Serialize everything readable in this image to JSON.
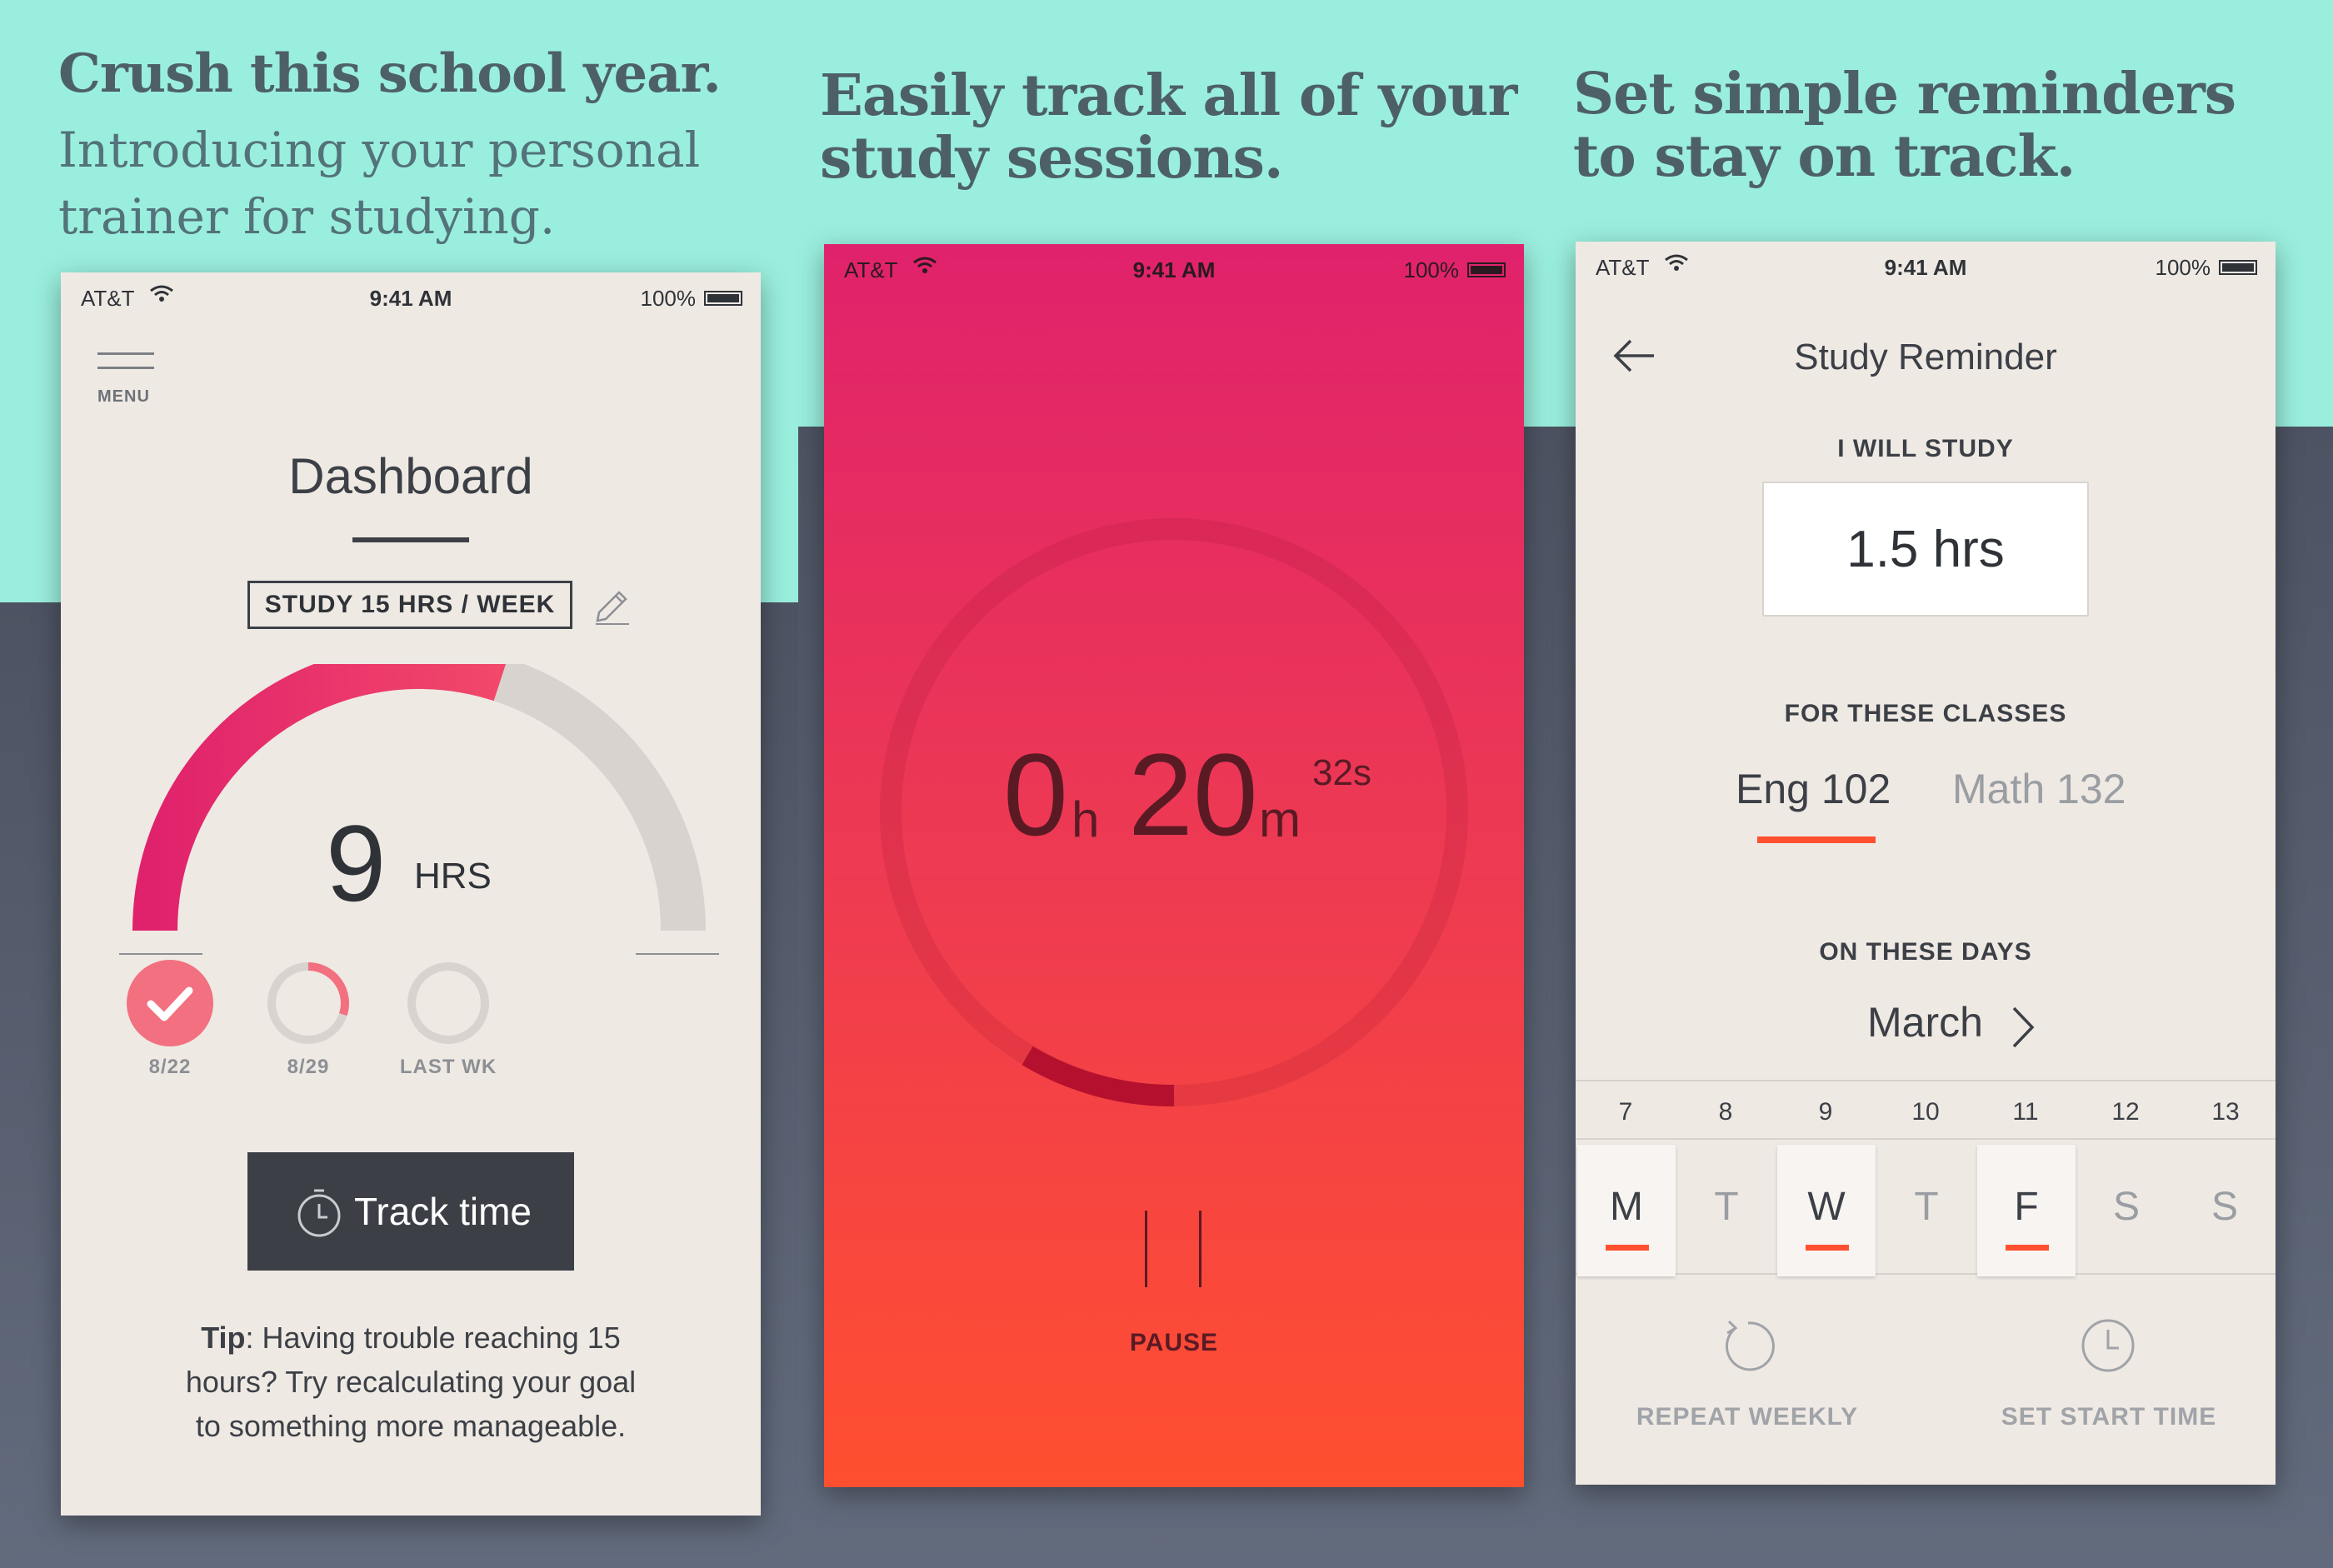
{
  "panels": [
    {
      "headline": "Crush this school year.",
      "subheadline_lines": [
        "Introducing your personal",
        "trainer for studying."
      ]
    },
    {
      "headline_lines": [
        "Easily track all of your",
        "study sessions."
      ]
    },
    {
      "headline_lines": [
        "Set simple reminders",
        "to stay on track."
      ]
    }
  ],
  "status_bar": {
    "carrier": "AT&T",
    "time": "9:41 AM",
    "battery": "100%"
  },
  "dashboard": {
    "menu_label": "MENU",
    "title": "Dashboard",
    "goal": "STUDY 15 HRS / WEEK",
    "hours_value": "9",
    "hours_unit": "HRS",
    "progress_fraction": 0.6,
    "weeks": [
      {
        "label": "8/22",
        "status": "complete"
      },
      {
        "label": "8/29",
        "status": "partial",
        "fraction": 0.3
      },
      {
        "label": "LAST WK",
        "status": "empty"
      }
    ],
    "track_button": "Track time",
    "tip_label": "Tip",
    "tip_lines": [
      ": Having trouble reaching 15",
      "hours? Try recalculating your goal",
      "to something more manageable."
    ]
  },
  "timer": {
    "hours": "0",
    "hours_suffix": "h",
    "minutes": "20",
    "minutes_suffix": "m",
    "seconds": "32s",
    "pause_label": "PAUSE"
  },
  "reminder": {
    "title": "Study Reminder",
    "will_study_label": "I WILL STUDY",
    "hours": "1.5 hrs",
    "classes_label": "FOR THESE CLASSES",
    "classes": [
      {
        "name": "Eng 102",
        "selected": true
      },
      {
        "name": "Math 132",
        "selected": false
      }
    ],
    "days_label": "ON THESE DAYS",
    "month": "March",
    "dates": [
      "7",
      "8",
      "9",
      "10",
      "11",
      "12",
      "13"
    ],
    "days": [
      {
        "letter": "M",
        "selected": true
      },
      {
        "letter": "T",
        "selected": false
      },
      {
        "letter": "W",
        "selected": true
      },
      {
        "letter": "T",
        "selected": false
      },
      {
        "letter": "F",
        "selected": true
      },
      {
        "letter": "S",
        "selected": false
      },
      {
        "letter": "S",
        "selected": false
      }
    ],
    "repeat_label": "REPEAT WEEKLY",
    "start_time_label": "SET START TIME"
  },
  "colors": {
    "background_top": "#9aeedd",
    "background_dark": "#565c6b",
    "headline": "#4d6068",
    "accent_pink": "#e02268",
    "accent_orange": "#ff5130",
    "paper": "#efe9e4"
  }
}
